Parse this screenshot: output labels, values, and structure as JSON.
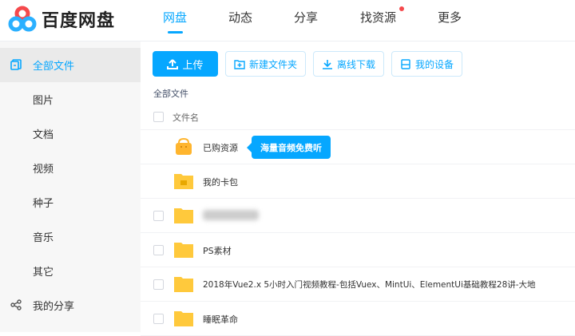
{
  "app": {
    "name": "百度网盘"
  },
  "nav": [
    {
      "label": "网盘",
      "active": true
    },
    {
      "label": "动态"
    },
    {
      "label": "分享"
    },
    {
      "label": "找资源",
      "badge": true
    },
    {
      "label": "更多"
    }
  ],
  "sidebar": [
    {
      "label": "全部文件",
      "active": true,
      "icon": "files-icon"
    },
    {
      "label": "图片"
    },
    {
      "label": "文档"
    },
    {
      "label": "视频"
    },
    {
      "label": "种子"
    },
    {
      "label": "音乐"
    },
    {
      "label": "其它"
    },
    {
      "label": "我的分享",
      "icon": "share-icon"
    }
  ],
  "toolbar": {
    "upload": "上传",
    "new_folder": "新建文件夹",
    "offline": "离线下载",
    "devices": "我的设备"
  },
  "breadcrumb": "全部文件",
  "list_header": "文件名",
  "tooltip": "海量音频免费听",
  "files": [
    {
      "name": "已购资源",
      "type": "bag"
    },
    {
      "name": "我的卡包",
      "type": "card"
    },
    {
      "name": "",
      "type": "folder",
      "blurred": true
    },
    {
      "name": "PS素材",
      "type": "folder"
    },
    {
      "name": "2018年Vue2.x 5小时入门视频教程-包括Vuex、MintUi、ElementUi基础教程28讲-大地",
      "type": "folder"
    },
    {
      "name": "睡眠革命",
      "type": "folder"
    }
  ],
  "colors": {
    "accent": "#06a7ff",
    "folder": "#ffc93c"
  }
}
